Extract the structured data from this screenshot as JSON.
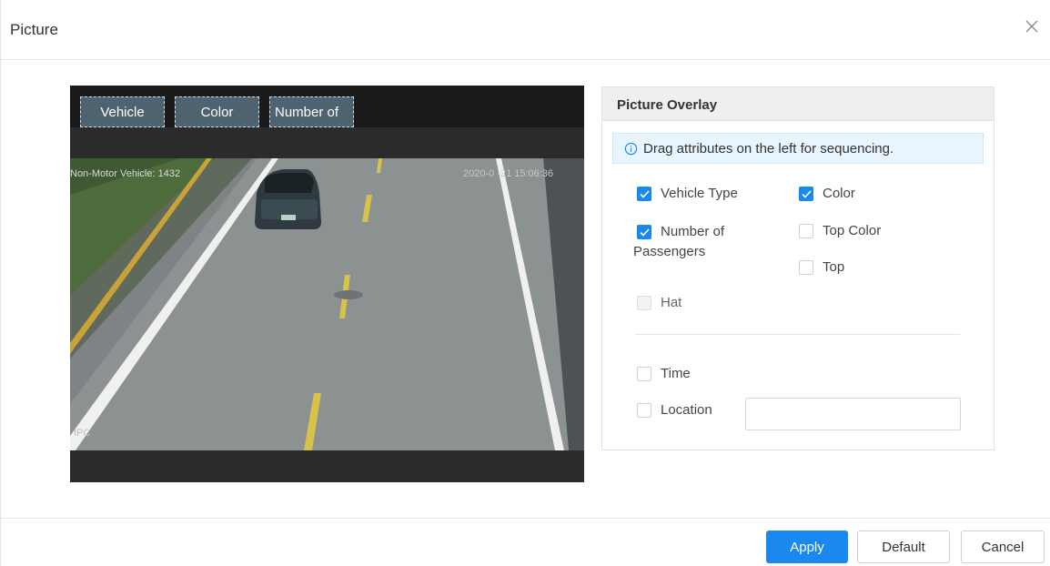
{
  "dialog": {
    "title": "Picture",
    "close_icon": "close-icon"
  },
  "preview": {
    "chips": [
      "Vehicle",
      "Color",
      "Number of"
    ],
    "osd_left": "Non-Motor Vehicle: 1432",
    "osd_right": "2020-0 -21 15:06:36",
    "osd_corner": "IPC"
  },
  "overlay": {
    "title": "Picture Overlay",
    "hint": "Drag attributes on the left for sequencing.",
    "hint_icon": "info-icon",
    "options": {
      "vehicle_type": {
        "label": "Vehicle Type",
        "checked": true
      },
      "color": {
        "label": "Color",
        "checked": true
      },
      "passengers": {
        "label_line1": "Number of",
        "label_line2": "Passengers",
        "checked": true
      },
      "top_color": {
        "label": "Top Color",
        "checked": false
      },
      "top": {
        "label": "Top",
        "checked": false
      },
      "hat": {
        "label": "Hat",
        "checked": false,
        "disabled": true
      },
      "time": {
        "label": "Time",
        "checked": false
      },
      "location": {
        "label": "Location",
        "checked": false
      }
    },
    "location_value": ""
  },
  "footer": {
    "apply": "Apply",
    "default": "Default",
    "cancel": "Cancel"
  },
  "colors": {
    "accent": "#1b88f0",
    "chip_bg": "#4f6270"
  }
}
